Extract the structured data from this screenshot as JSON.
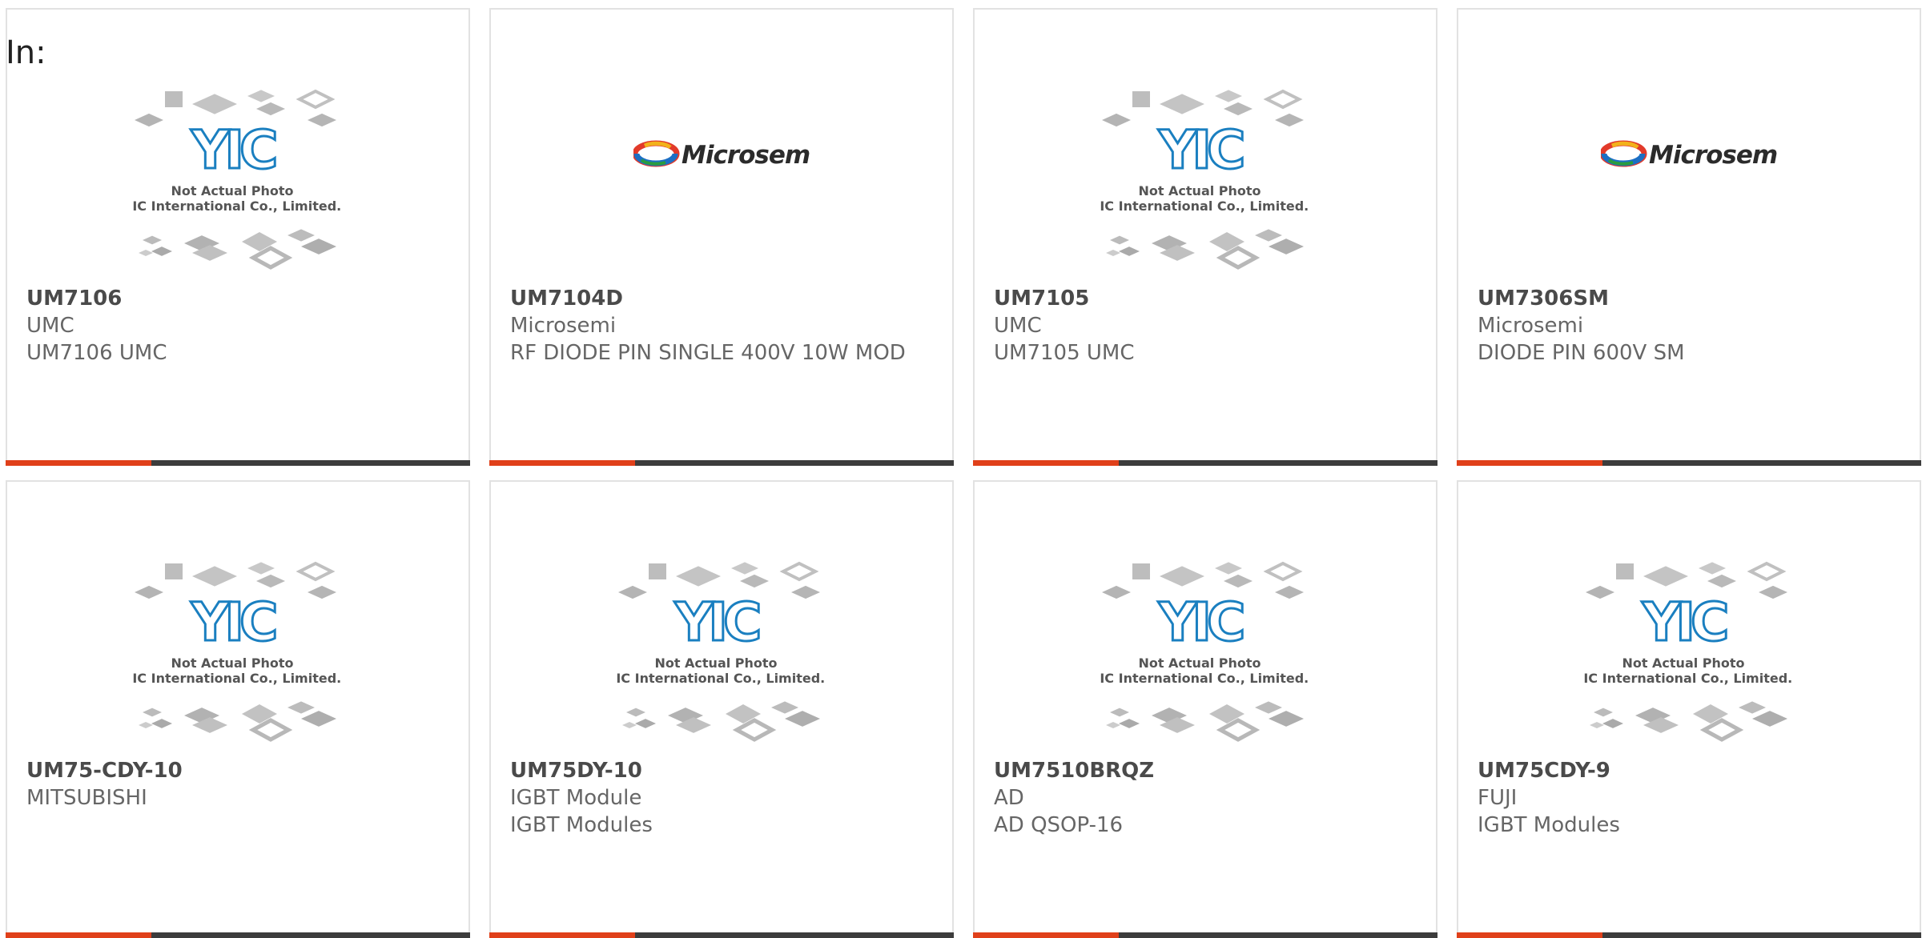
{
  "page": {
    "in_label": "In:"
  },
  "placeholder": {
    "line1": "Not Actual Photo",
    "line2": "YIC International Co., Limited.",
    "logo": "YIC"
  },
  "microsemi": {
    "logo": "Microsemi"
  },
  "products": [
    {
      "part": "UM7106",
      "manufacturer": "UMC",
      "description": "UM7106 UMC",
      "image": "yic-placeholder"
    },
    {
      "part": "UM7104D",
      "manufacturer": "Microsemi",
      "description": "RF DIODE PIN SINGLE 400V 10W MOD",
      "image": "microsemi-logo"
    },
    {
      "part": "UM7105",
      "manufacturer": "UMC",
      "description": "UM7105 UMC",
      "image": "yic-placeholder"
    },
    {
      "part": "UM7306SM",
      "manufacturer": "Microsemi",
      "description": "DIODE PIN 600V SM",
      "image": "microsemi-logo"
    },
    {
      "part": "UM75-CDY-10",
      "manufacturer": "MITSUBISHI",
      "description": "",
      "image": "yic-placeholder"
    },
    {
      "part": "UM75DY-10",
      "manufacturer": "IGBT Module",
      "description": "IGBT Modules",
      "image": "yic-placeholder"
    },
    {
      "part": "UM7510BRQZ",
      "manufacturer": "AD",
      "description": "AD QSOP-16",
      "image": "yic-placeholder"
    },
    {
      "part": "UM75CDY-9",
      "manufacturer": "FUJI",
      "description": "IGBT Modules",
      "image": "yic-placeholder"
    }
  ],
  "colors": {
    "accent": "#e0401a",
    "bar": "#3c3c3c",
    "border": "#e2e2e2",
    "yic_blue": "#1a7fc0"
  }
}
